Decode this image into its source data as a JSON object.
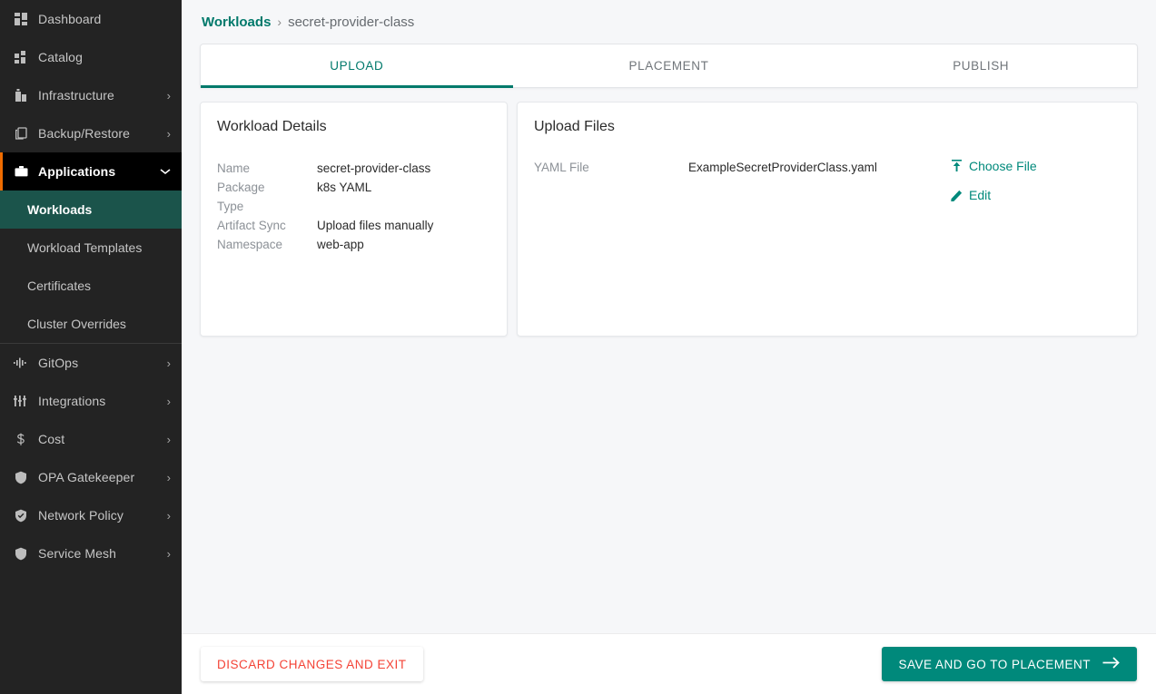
{
  "colors": {
    "brand_teal": "#00796b",
    "button_teal": "#00897b",
    "sidebar_active_teal": "#1b544b",
    "sidebar_bg": "#232323",
    "accent_orange": "#ef6c00",
    "danger_red": "#f44336",
    "page_bg": "#f6f7f9"
  },
  "sidebar": {
    "items": [
      {
        "label": "Dashboard",
        "icon": "dashboard-icon",
        "has_chevron": false,
        "state": "normal"
      },
      {
        "label": "Catalog",
        "icon": "catalog-grid-icon",
        "has_chevron": false,
        "state": "normal"
      },
      {
        "label": "Infrastructure",
        "icon": "building-icon",
        "has_chevron": true,
        "state": "normal"
      },
      {
        "label": "Backup/Restore",
        "icon": "copy-icon",
        "has_chevron": true,
        "state": "normal"
      },
      {
        "label": "Applications",
        "icon": "briefcase-icon",
        "has_chevron": true,
        "state": "expanded"
      }
    ],
    "sub_items": [
      {
        "label": "Workloads",
        "active": true
      },
      {
        "label": "Workload Templates",
        "active": false
      },
      {
        "label": "Certificates",
        "active": false
      },
      {
        "label": "Cluster Overrides",
        "active": false
      }
    ],
    "items_bottom": [
      {
        "label": "GitOps",
        "icon": "waveform-icon",
        "has_chevron": true,
        "state": "normal"
      },
      {
        "label": "Integrations",
        "icon": "sliders-icon",
        "has_chevron": true,
        "state": "normal"
      },
      {
        "label": "Cost",
        "icon": "dollar-icon",
        "has_chevron": true,
        "state": "normal"
      },
      {
        "label": "OPA Gatekeeper",
        "icon": "shield-icon",
        "has_chevron": true,
        "state": "normal"
      },
      {
        "label": "Network Policy",
        "icon": "shield-check-icon",
        "has_chevron": true,
        "state": "normal"
      },
      {
        "label": "Service Mesh",
        "icon": "shield-icon",
        "has_chevron": true,
        "state": "normal"
      }
    ],
    "chevron_right": "›",
    "chevron_down": "⌄"
  },
  "breadcrumb": {
    "parent": "Workloads",
    "separator": "›",
    "current": "secret-provider-class"
  },
  "tabs": [
    {
      "label": "UPLOAD",
      "active": true
    },
    {
      "label": "PLACEMENT",
      "active": false
    },
    {
      "label": "PUBLISH",
      "active": false
    }
  ],
  "details_card": {
    "title": "Workload Details",
    "rows": [
      {
        "key": "Name",
        "value": "secret-provider-class"
      },
      {
        "key": "Package",
        "value": "k8s YAML"
      },
      {
        "key": "Type",
        "value": ""
      },
      {
        "key": "Artifact Sync",
        "value": "Upload files manually"
      },
      {
        "key": "Namespace",
        "value": "web-app"
      }
    ]
  },
  "upload_card": {
    "title": "Upload Files",
    "row": {
      "key": "YAML File",
      "value": "ExampleSecretProviderClass.yaml"
    },
    "actions": [
      {
        "label": "Choose File",
        "icon": "upload-icon"
      },
      {
        "label": "Edit",
        "icon": "pencil-icon"
      }
    ]
  },
  "footer": {
    "discard_label": "DISCARD CHANGES AND EXIT",
    "save_label": "SAVE AND GO TO PLACEMENT",
    "save_icon": "arrow-right-icon"
  }
}
